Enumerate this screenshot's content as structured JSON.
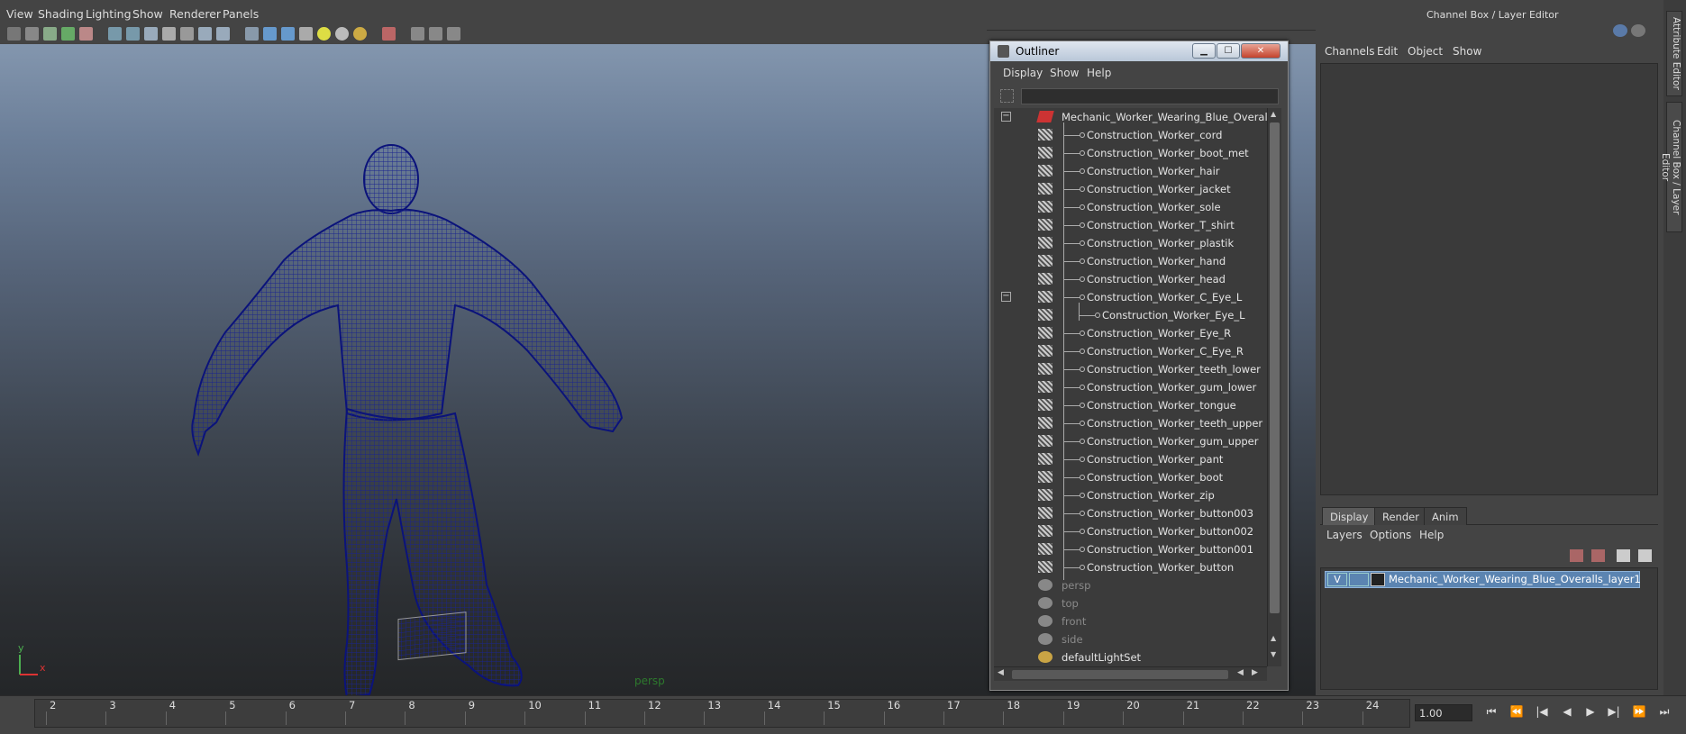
{
  "menubar": {
    "items": [
      "View",
      "Shading",
      "Lighting",
      "Show",
      "Renderer",
      "Panels"
    ]
  },
  "viewport": {
    "camera_label": "persp",
    "axis": {
      "y": "y",
      "x": "x"
    }
  },
  "right_panel": {
    "title": "Channel Box / Layer Editor",
    "channel_box_menu": [
      "Channels",
      "Edit",
      "Object",
      "Show"
    ],
    "layer_tabs": [
      "Display",
      "Render",
      "Anim"
    ],
    "active_tab": "Display",
    "layer_menu": [
      "Layers",
      "Options",
      "Help"
    ],
    "layer": {
      "visible": "V",
      "name": "Mechanic_Worker_Wearing_Blue_Overalls_layer1"
    }
  },
  "side_tabs": [
    "Attribute Editor",
    "Channel Box / Layer Editor"
  ],
  "outliner": {
    "title": "Outliner",
    "menu": [
      "Display",
      "Show",
      "Help"
    ],
    "root": "Mechanic_Worker_Wearing_Blue_Overalls",
    "children": [
      "Construction_Worker_cord",
      "Construction_Worker_boot_met",
      "Construction_Worker_hair",
      "Construction_Worker_jacket",
      "Construction_Worker_sole",
      "Construction_Worker_T_shirt",
      "Construction_Worker_plastik",
      "Construction_Worker_hand",
      "Construction_Worker_head",
      "Construction_Worker_C_Eye_L",
      "Construction_Worker_Eye_L",
      "Construction_Worker_Eye_R",
      "Construction_Worker_C_Eye_R",
      "Construction_Worker_teeth_lower",
      "Construction_Worker_gum_lower",
      "Construction_Worker_tongue",
      "Construction_Worker_teeth_upper",
      "Construction_Worker_gum_upper",
      "Construction_Worker_pant",
      "Construction_Worker_boot",
      "Construction_Worker_zip",
      "Construction_Worker_button003",
      "Construction_Worker_button002",
      "Construction_Worker_button001",
      "Construction_Worker_button"
    ],
    "cameras": [
      "persp",
      "top",
      "front",
      "side"
    ],
    "sets": [
      "defaultLightSet"
    ]
  },
  "timeslider": {
    "frames": [
      "2",
      "3",
      "4",
      "5",
      "6",
      "7",
      "8",
      "9",
      "10",
      "11",
      "12",
      "13",
      "14",
      "15",
      "16",
      "17",
      "18",
      "19",
      "20",
      "21",
      "22",
      "23",
      "24"
    ],
    "current_frame": "1.00",
    "playback": [
      "⏮",
      "⏪",
      "|◀",
      "◀",
      "▶",
      "▶|",
      "⏩",
      "⏭"
    ]
  },
  "colors": {
    "wireframe": "#0b137a",
    "layer_highlight": "#5b84b1"
  }
}
